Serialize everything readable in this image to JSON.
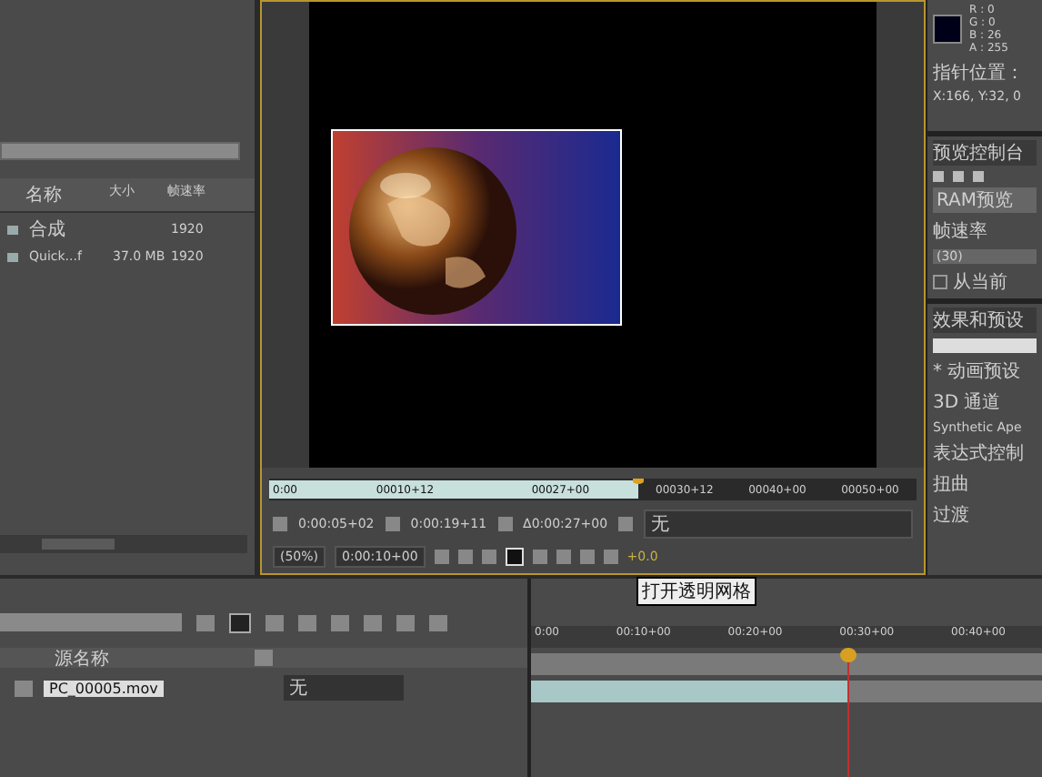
{
  "project": {
    "columns": [
      "名称",
      "大小",
      "帧速率"
    ],
    "rows": [
      {
        "name": "合成",
        "size": "",
        "fps": "1920"
      },
      {
        "name": "Quick...f",
        "size": "37.0 MB",
        "fps": "1920"
      }
    ]
  },
  "viewer": {
    "ruler": [
      "0:00",
      "00010+12",
      "00027+00",
      "00030+12",
      "00040+00",
      "00050+00"
    ],
    "work_area": {
      "level": 0.57
    },
    "playhead": {
      "level": 0.57
    },
    "times": [
      "0:00:05+02",
      "0:00:19+11",
      "Δ0:00:27+00"
    ],
    "view": "无",
    "zoom": "(50%)",
    "current_time": "0:00:10+00",
    "exposure": "+0.0"
  },
  "tooltip": "打开透明网格",
  "info": {
    "channels": [
      "R : 0",
      "G : 0",
      "B : 26",
      "A : 255"
    ],
    "pointer_label": "指针位置：",
    "pointer_value": "X:166, Y:32, 0"
  },
  "preview": {
    "title": "预览控制台",
    "options": "RAM预览",
    "fps_label": "帧速率",
    "fps_value": "(30)",
    "from_current": {
      "label": "从当前",
      "checked": false
    }
  },
  "effects": {
    "title": "效果和预设",
    "items": [
      "* 动画预设",
      "3D 通道",
      "Synthetic Ape",
      "表达式控制",
      "扭曲",
      "过渡"
    ]
  },
  "timeline": {
    "column": "源名称",
    "layers": [
      {
        "name": "PC_00005.mov",
        "parent": "无"
      }
    ],
    "ruler": [
      "0:00",
      "00:10+00",
      "00:20+00",
      "00:30+00",
      "00:40+00"
    ],
    "playhead": {
      "level": 0.62
    },
    "bar": {
      "level": 0.62
    }
  }
}
